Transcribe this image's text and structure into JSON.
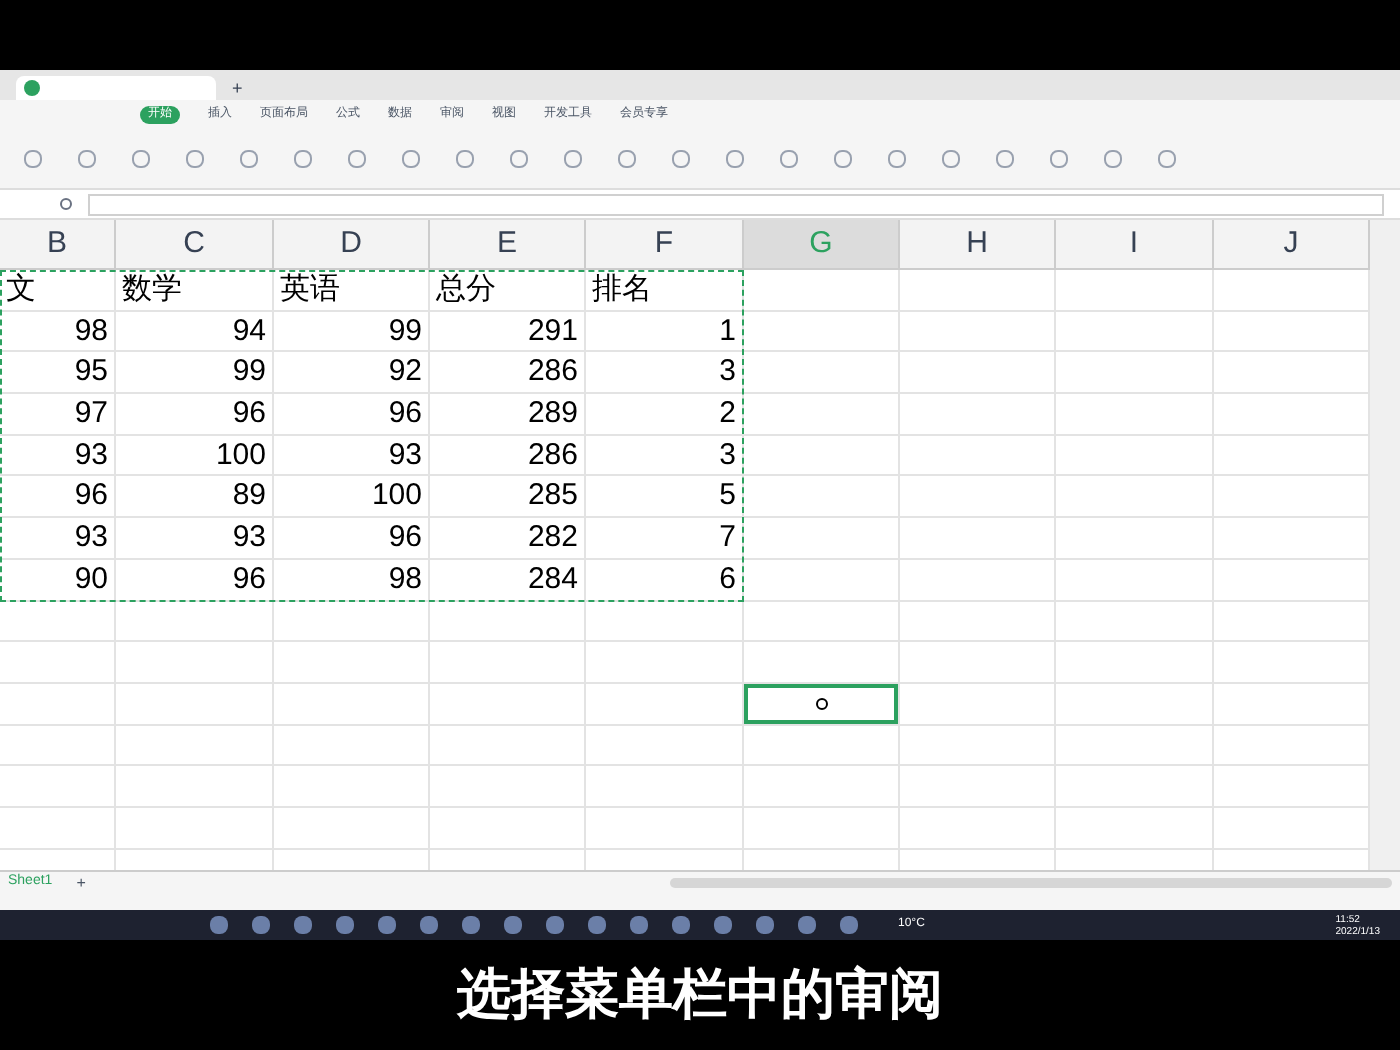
{
  "title_tab": {
    "new_tab": "+"
  },
  "menu": [
    {
      "label": "开始",
      "selected": true
    },
    {
      "label": "插入",
      "selected": false
    },
    {
      "label": "页面布局",
      "selected": false
    },
    {
      "label": "公式",
      "selected": false
    },
    {
      "label": "数据",
      "selected": false
    },
    {
      "label": "审阅",
      "selected": false
    },
    {
      "label": "视图",
      "selected": false
    },
    {
      "label": "开发工具",
      "selected": false
    },
    {
      "label": "会员专享",
      "selected": false
    }
  ],
  "columns": [
    {
      "label": "B",
      "selected": false
    },
    {
      "label": "C",
      "selected": false
    },
    {
      "label": "D",
      "selected": false
    },
    {
      "label": "E",
      "selected": false
    },
    {
      "label": "F",
      "selected": false
    },
    {
      "label": "G",
      "selected": true
    },
    {
      "label": "H",
      "selected": false
    },
    {
      "label": "I",
      "selected": false
    },
    {
      "label": "J",
      "selected": false
    }
  ],
  "header_row": [
    "文",
    "数学",
    "英语",
    "总分",
    "排名"
  ],
  "rows": [
    [
      "98",
      "94",
      "99",
      "291",
      "1"
    ],
    [
      "95",
      "99",
      "92",
      "286",
      "3"
    ],
    [
      "97",
      "96",
      "96",
      "289",
      "2"
    ],
    [
      "93",
      "100",
      "93",
      "286",
      "3"
    ],
    [
      "96",
      "89",
      "100",
      "285",
      "5"
    ],
    [
      "93",
      "93",
      "96",
      "282",
      "7"
    ],
    [
      "90",
      "96",
      "98",
      "284",
      "6"
    ]
  ],
  "sheet_tabs": [
    {
      "label": "Sheet1",
      "selected": true
    }
  ],
  "add_sheet": "+",
  "taskbar": {
    "weather": "10°C",
    "time": "11:52",
    "date": "2022/1/13"
  },
  "subtitle": "选择菜单栏中的审阅"
}
